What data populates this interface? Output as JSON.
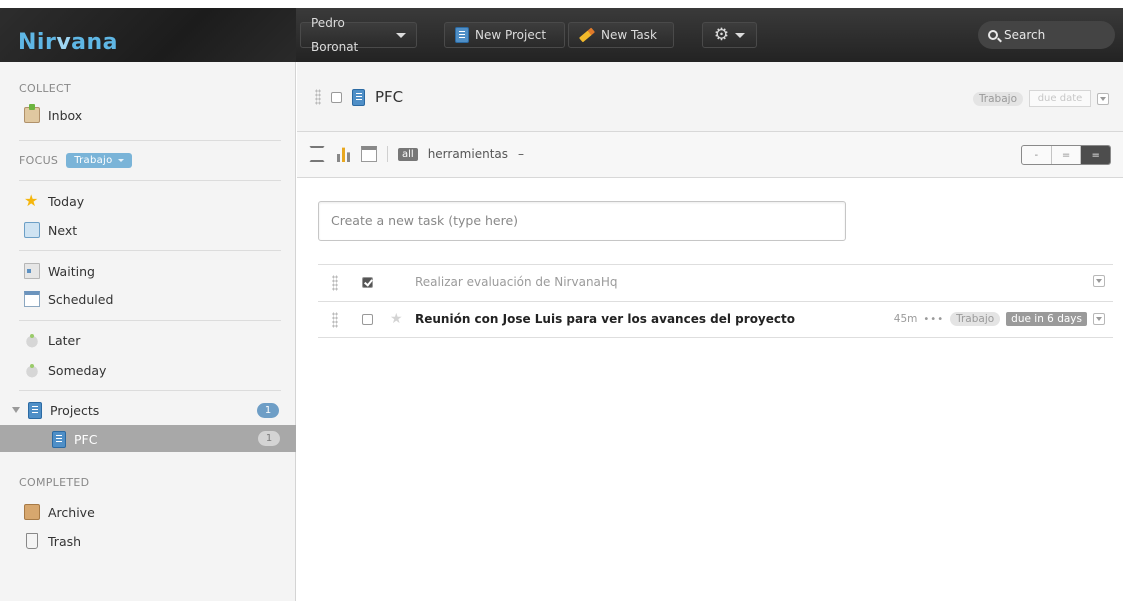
{
  "app": {
    "logo_text_a": "Nir",
    "logo_text_v": "v",
    "logo_text_b": "ana"
  },
  "toolbar": {
    "user_label": "Pedro Boronat",
    "new_project_label": "New Project",
    "new_task_label": "New Task",
    "search_label": "Search"
  },
  "sidebar": {
    "collect_label": "COLLECT",
    "inbox_label": "Inbox",
    "focus_label": "FOCUS",
    "focus_value": "Trabajo",
    "today_label": "Today",
    "next_label": "Next",
    "waiting_label": "Waiting",
    "scheduled_label": "Scheduled",
    "later_label": "Later",
    "someday_label": "Someday",
    "projects_label": "Projects",
    "projects_count": "1",
    "project_pfc_label": "PFC",
    "project_pfc_count": "1",
    "completed_label": "COMPLETED",
    "archive_label": "Archive",
    "trash_label": "Trash"
  },
  "project": {
    "title": "PFC",
    "tag": "Trabajo",
    "due_placeholder": "due date"
  },
  "filters": {
    "all_badge": "all",
    "tag_text": "herramientas",
    "dash": "–",
    "view_options": [
      "-",
      "=",
      "="
    ]
  },
  "new_task": {
    "placeholder": "Create a new task (type here)"
  },
  "tasks": [
    {
      "title": "Realizar evaluación de NirvanaHq",
      "completed": true
    },
    {
      "title": "Reunión con Jose Luis para ver los avances del proyecto",
      "completed": false,
      "time": "45m",
      "dots": "•••",
      "tag": "Trabajo",
      "due": "due in 6 days"
    }
  ]
}
